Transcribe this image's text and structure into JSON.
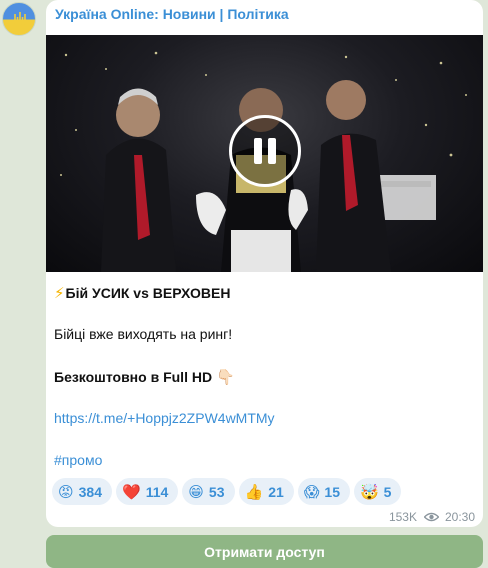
{
  "channel": {
    "name": "Україна Online: Новини | Політика"
  },
  "media": {
    "state": "playing",
    "overlay_icon": "pause-icon"
  },
  "message": {
    "title_emoji": "⚡",
    "title": "Бій УСИК vs ВЕРХОВЕН",
    "line2": "Бійці вже виходять на ринг!",
    "line3": "Безкоштовно в Full HD",
    "line3_emoji": "👇🏻",
    "link": "https://t.me/+Hoppjz2ZPW4wMTMy",
    "hashtag": "#промо"
  },
  "reactions": [
    {
      "emoji": "😡",
      "count": "384"
    },
    {
      "emoji": "❤️",
      "count": "114"
    },
    {
      "emoji": "😁",
      "count": "53"
    },
    {
      "emoji": "👍",
      "count": "21"
    },
    {
      "emoji": "😱",
      "count": "15"
    },
    {
      "emoji": "🤯",
      "count": "5"
    }
  ],
  "meta": {
    "views": "153K",
    "views_icon": "eye-icon",
    "time": "20:30"
  },
  "cta": {
    "label": "Отримати доступ"
  },
  "colors": {
    "chat_bg": "#dfe7d9",
    "accent": "#3b8fd6",
    "button_bg": "#8fb685",
    "reaction_bg": "#e8f0f8"
  }
}
